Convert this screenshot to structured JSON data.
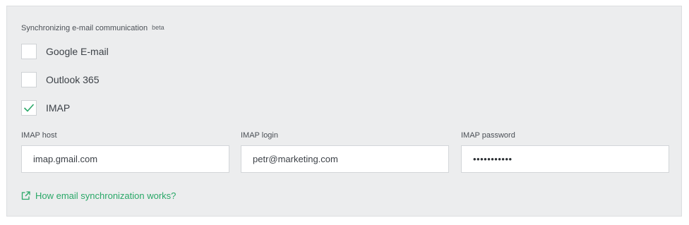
{
  "section": {
    "title": "Synchronizing e-mail communication",
    "badge": "beta"
  },
  "providers": [
    {
      "label": "Google E-mail",
      "checked": false
    },
    {
      "label": "Outlook 365",
      "checked": false
    },
    {
      "label": "IMAP",
      "checked": true
    }
  ],
  "imap": {
    "host_label": "IMAP host",
    "host_value": "imap.gmail.com",
    "login_label": "IMAP login",
    "login_value": "petr@marketing.com",
    "password_label": "IMAP password",
    "password_mask": "•••••••••••"
  },
  "help": {
    "link_text": "How email synchronization works?",
    "icon": "external-link-icon"
  },
  "colors": {
    "accent": "#2aa868",
    "panel_bg": "#ecedee"
  }
}
